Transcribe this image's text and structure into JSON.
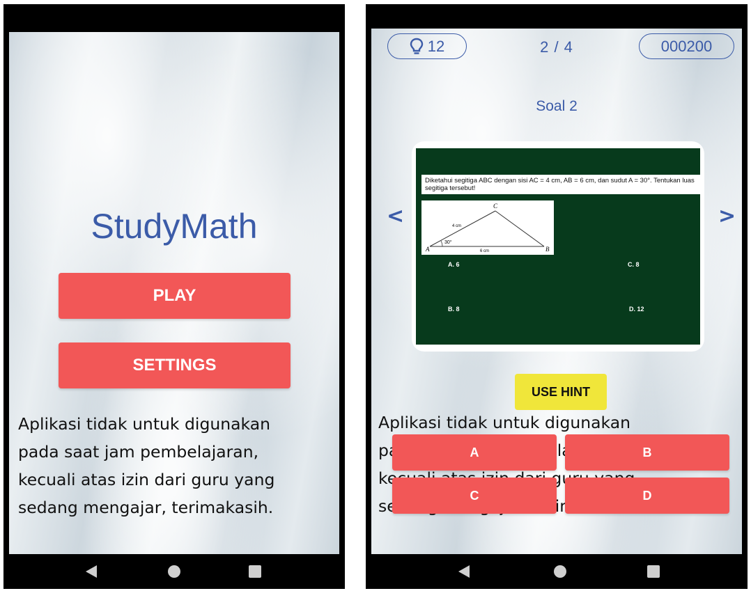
{
  "left_screen": {
    "app_title": "StudyMath",
    "play_label": "PLAY",
    "settings_label": "SETTINGS",
    "notice_lines": [
      "Aplikasi tidak untuk digunakan",
      "pada saat jam pembelajaran,",
      "kecuali atas izin dari guru yang",
      "sedang mengajar, terimakasih."
    ]
  },
  "right_screen": {
    "hint_count": "12",
    "progress": "2 / 4",
    "score": "000200",
    "question_title": "Soal 2",
    "question": {
      "text": "Diketahui segitiga ABC dengan sisi AC = 4 cm, AB = 6 cm, dan sudut A = 30°. Tentukan luas segitiga tersebut!",
      "figure": {
        "vertex_a": "A",
        "vertex_b": "B",
        "vertex_c": "C",
        "side_ac": "4 cm",
        "side_ab": "6 cm",
        "angle_a": "30°"
      },
      "options": {
        "a": "A. 6",
        "b": "B. 8",
        "c": "C. 8",
        "d": "D. 12"
      }
    },
    "prev_arrow": "<",
    "next_arrow": ">",
    "use_hint_label": "USE HINT",
    "notice_lines": [
      "Aplikasi tidak untuk digunakan",
      "pada saat jam pembelajaran,",
      "kecuali atas izin dari guru yang",
      "sedang mengajar, terimakasih."
    ],
    "answers": [
      "A",
      "B",
      "C",
      "D"
    ]
  },
  "colors": {
    "accent_blue": "#3b5ba8",
    "button_red": "#f25757",
    "hint_yellow": "#f0e63a",
    "board_green": "#073a1c"
  },
  "icons": {
    "hint": "lightbulb-icon",
    "nav_back": "back-triangle-icon",
    "nav_home": "home-circle-icon",
    "nav_recent": "recent-square-icon"
  }
}
